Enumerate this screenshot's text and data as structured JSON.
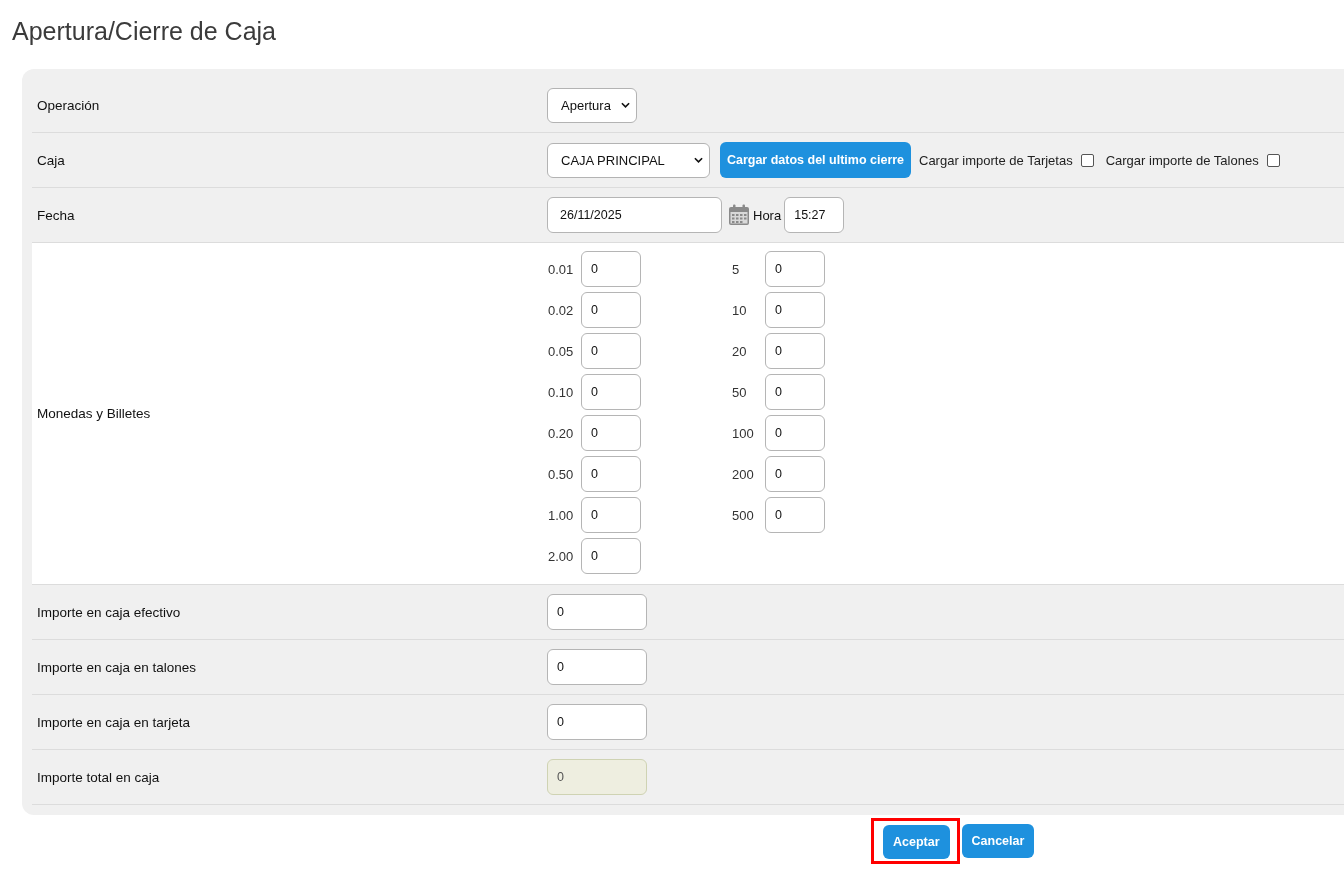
{
  "title": "Apertura/Cierre de Caja",
  "form": {
    "rows": [
      {
        "kind": "select",
        "label": "Operación",
        "value": "Apertura"
      },
      {
        "kind": "caja",
        "label": "Caja",
        "value": "CAJA PRINCIPAL",
        "button": "Cargar datos del ultimo cierre",
        "checkboxes": [
          {
            "label": "Cargar importe de Tarjetas",
            "checked": false
          },
          {
            "label": "Cargar importe de Talones",
            "checked": false
          }
        ]
      },
      {
        "kind": "fecha",
        "label": "Fecha",
        "value": "26/11/2025",
        "time_label": "Hora",
        "time_value": "15:27"
      },
      {
        "kind": "denominations",
        "label": "Monedas y Billetes",
        "columns": [
          [
            {
              "label": "0.01",
              "value": "0"
            },
            {
              "label": "0.02",
              "value": "0"
            },
            {
              "label": "0.05",
              "value": "0"
            },
            {
              "label": "0.10",
              "value": "0"
            },
            {
              "label": "0.20",
              "value": "0"
            },
            {
              "label": "0.50",
              "value": "0"
            },
            {
              "label": "1.00",
              "value": "0"
            },
            {
              "label": "2.00",
              "value": "0"
            }
          ],
          [
            {
              "label": "5",
              "value": "0"
            },
            {
              "label": "10",
              "value": "0"
            },
            {
              "label": "20",
              "value": "0"
            },
            {
              "label": "50",
              "value": "0"
            },
            {
              "label": "100",
              "value": "0"
            },
            {
              "label": "200",
              "value": "0"
            },
            {
              "label": "500",
              "value": "0"
            }
          ]
        ]
      },
      {
        "kind": "input",
        "label": "Importe en caja efectivo",
        "value": "0",
        "readonly": false
      },
      {
        "kind": "input",
        "label": "Importe en caja en talones",
        "value": "0",
        "readonly": false
      },
      {
        "kind": "input",
        "label": "Importe en caja en tarjeta",
        "value": "0",
        "readonly": false
      },
      {
        "kind": "input",
        "label": "Importe total en caja",
        "value": "0",
        "readonly": true
      }
    ]
  },
  "buttons": [
    {
      "label": "Aceptar",
      "highlighted": true
    },
    {
      "label": "Cancelar",
      "highlighted": false
    }
  ]
}
